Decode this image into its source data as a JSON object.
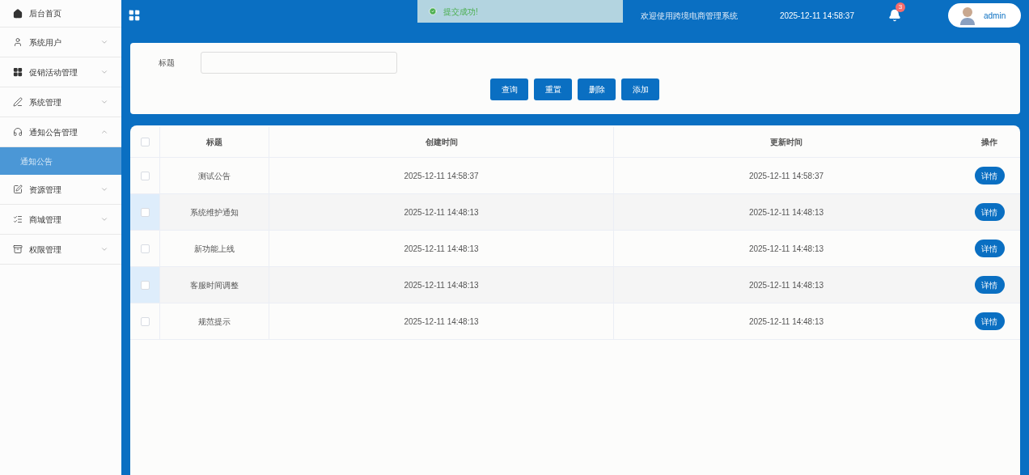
{
  "sidebar": {
    "items": [
      {
        "label": "后台首页"
      },
      {
        "label": "系统用户",
        "expanded": false
      },
      {
        "label": "促销活动管理",
        "expanded": false
      },
      {
        "label": "系统管理",
        "expanded": false
      },
      {
        "label": "通知公告管理",
        "expanded": true,
        "children": [
          {
            "label": "通知公告",
            "selected": true
          }
        ]
      },
      {
        "label": "资源管理",
        "expanded": false
      },
      {
        "label": "商城管理",
        "expanded": false
      },
      {
        "label": "权限管理",
        "expanded": false
      }
    ]
  },
  "header": {
    "title": "欢迎使用跨境电商管理系统",
    "datetime": "2025-12-11 14:58:37",
    "notifications": "3",
    "user": "admin"
  },
  "toast": {
    "message": "提交成功!"
  },
  "search": {
    "label": "标题",
    "buttons": [
      "查询",
      "重置",
      "删除",
      "添加"
    ]
  },
  "table": {
    "select_all_checked": false,
    "columns": [
      "标题",
      "创建时间",
      "更新时间",
      "操作"
    ],
    "rows": [
      {
        "checked": false,
        "title": "测试公告",
        "created": "2025-12-11 14:58:37",
        "updated": "2025-12-11 14:58:37",
        "action": "详情"
      },
      {
        "checked": false,
        "title": "系统维护通知",
        "created": "2025-12-11 14:48:13",
        "updated": "2025-12-11 14:48:13",
        "action": "详情"
      },
      {
        "checked": false,
        "title": "新功能上线",
        "created": "2025-12-11 14:48:13",
        "updated": "2025-12-11 14:48:13",
        "action": "详情"
      },
      {
        "checked": false,
        "title": "客服时间调整",
        "created": "2025-12-11 14:48:13",
        "updated": "2025-12-11 14:48:13",
        "action": "详情"
      },
      {
        "checked": false,
        "title": "规范提示",
        "created": "2025-12-11 14:48:13",
        "updated": "2025-12-11 14:48:13",
        "action": "详情"
      }
    ]
  }
}
